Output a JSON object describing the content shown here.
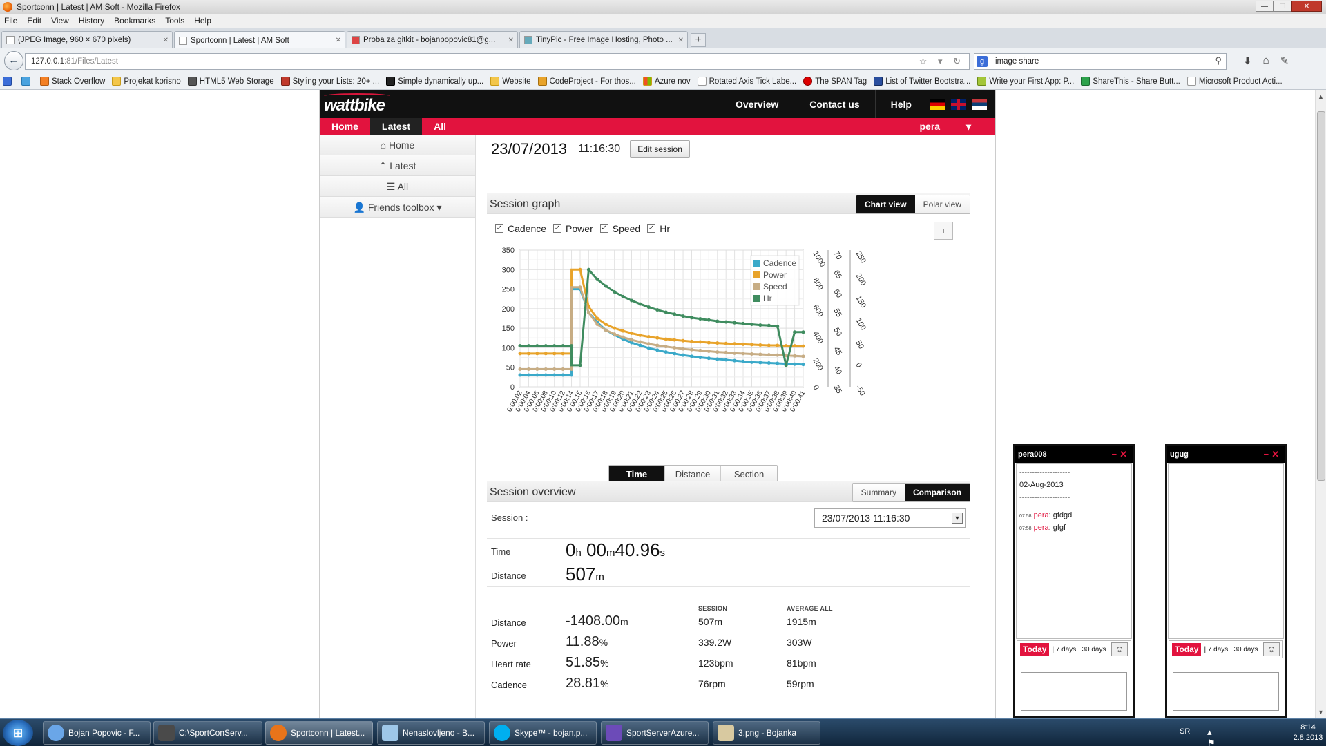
{
  "window": {
    "title": "Sportconn | Latest | AM Soft - Mozilla Firefox"
  },
  "menu": [
    "File",
    "Edit",
    "View",
    "History",
    "Bookmarks",
    "Tools",
    "Help"
  ],
  "tabs": [
    {
      "label": "(JPEG Image, 960 × 670 pixels)",
      "active": false
    },
    {
      "label": "Sportconn | Latest | AM Soft",
      "active": true
    },
    {
      "label": "Proba za gitkit - bojanpopovic81@g...",
      "active": false
    },
    {
      "label": "TinyPic - Free Image Hosting, Photo ...",
      "active": false
    }
  ],
  "address": {
    "host": "127.0.0.1",
    "rest": ":81/Files/Latest"
  },
  "search": {
    "value": "image share"
  },
  "bookmarks": [
    "Stack Overflow",
    "Projekat korisno",
    "HTML5 Web Storage",
    "Styling your Lists: 20+ ...",
    "Simple dynamically up...",
    "Website",
    "CodeProject - For thos...",
    "Azure nov",
    "Rotated Axis Tick Labe...",
    "The SPAN Tag",
    "List of Twitter Bootstra...",
    "Write your First App: P...",
    "ShareThis - Share Butt...",
    "Microsoft Product Acti..."
  ],
  "site": {
    "logo": "wattbike",
    "topnav": [
      "Overview",
      "Contact us",
      "Help"
    ],
    "subnav": [
      "Home",
      "Latest",
      "All"
    ],
    "user": "pera",
    "sidebar": [
      "Home",
      "Latest",
      "All",
      "Friends toolbox"
    ],
    "session_date": "23/07/2013",
    "session_time": "11:16:30",
    "edit_btn": "Edit session",
    "graph_title": "Session graph",
    "chart_view": "Chart view",
    "polar_view": "Polar view",
    "series_checks": [
      "Cadence",
      "Power",
      "Speed",
      "Hr"
    ],
    "zoom": "+",
    "xaxis_modes": [
      "Time",
      "Distance",
      "Section"
    ],
    "overview_title": "Session overview",
    "summary_btn": "Summary",
    "comparison_btn": "Comparison",
    "session_label": "Session :",
    "session_select": "23/07/2013 11:16:30",
    "time_label": "Time",
    "time_h": "0",
    "time_h_unit": "h",
    "time_m": " 00",
    "time_m_unit": "m",
    "time_s": "40.96",
    "time_s_unit": "s",
    "distance_label": "Distance",
    "distance_val": "507",
    "distance_unit": "m",
    "col_session": "SESSION",
    "col_avg": "AVERAGE ALL",
    "stats": [
      {
        "label": "Distance",
        "pct": "-1408.00",
        "unit": "m",
        "session": "507m",
        "avg": "1915m"
      },
      {
        "label": "Power",
        "pct": "11.88",
        "unit": "%",
        "session": "339.2W",
        "avg": "303W"
      },
      {
        "label": "Heart rate",
        "pct": "51.85",
        "unit": "%",
        "session": "123bpm",
        "avg": "81bpm"
      },
      {
        "label": "Cadence",
        "pct": "28.81",
        "unit": "%",
        "session": "76rpm",
        "avg": "59rpm"
      }
    ]
  },
  "chart_data": {
    "type": "line",
    "x": [
      "0:00:02",
      "0:00:04",
      "0:00:06",
      "0:00:08",
      "0:00:10",
      "0:00:12",
      "0:00:14",
      "0:00:15",
      "0:00:16",
      "0:00:17",
      "0:00:18",
      "0:00:19",
      "0:00:20",
      "0:00:21",
      "0:00:22",
      "0:00:23",
      "0:00:24",
      "0:00:25",
      "0:00:26",
      "0:00:27",
      "0:00:28",
      "0:00:29",
      "0:00:30",
      "0:00:31",
      "0:00:32",
      "0:00:33",
      "0:00:34",
      "0:00:35",
      "0:00:36",
      "0:00:37",
      "0:00:38",
      "0:00:39",
      "0:00:40",
      "0:00:41"
    ],
    "series": [
      {
        "name": "Cadence",
        "color": "#3aa9c9",
        "values": [
          30,
          30,
          30,
          30,
          30,
          30,
          30,
          250,
          190,
          165,
          145,
          133,
          122,
          113,
          106,
          99,
          94,
          89,
          85,
          81,
          78,
          75,
          73,
          71,
          69,
          67,
          65,
          63,
          62,
          61,
          60,
          59,
          58,
          57
        ]
      },
      {
        "name": "Power",
        "color": "#e8a32a",
        "values": [
          85,
          85,
          85,
          85,
          85,
          85,
          85,
          300,
          205,
          175,
          160,
          150,
          143,
          137,
          132,
          128,
          125,
          122,
          120,
          118,
          116,
          115,
          113,
          112,
          111,
          110,
          109,
          108,
          107,
          106,
          106,
          105,
          105,
          104
        ]
      },
      {
        "name": "Speed",
        "color": "#c7ad85",
        "values": [
          45,
          45,
          45,
          45,
          45,
          45,
          45,
          255,
          190,
          160,
          145,
          135,
          127,
          120,
          115,
          110,
          106,
          103,
          100,
          97,
          95,
          93,
          91,
          89,
          88,
          86,
          85,
          84,
          83,
          82,
          81,
          80,
          79,
          78
        ]
      },
      {
        "name": "Hr",
        "color": "#3f8c5f",
        "values": [
          105,
          105,
          105,
          105,
          105,
          105,
          105,
          55,
          300,
          275,
          258,
          243,
          231,
          221,
          212,
          204,
          197,
          191,
          186,
          181,
          177,
          174,
          171,
          168,
          166,
          164,
          162,
          160,
          158,
          157,
          155,
          55,
          140,
          140
        ]
      }
    ],
    "y_axes": [
      {
        "ticks": [
          "350",
          "300",
          "250",
          "200",
          "150",
          "100",
          "50",
          "0"
        ]
      },
      {
        "ticks": [
          "1000",
          "800",
          "600",
          "400",
          "200",
          "0"
        ]
      },
      {
        "ticks": [
          "70",
          "65",
          "60",
          "55",
          "50",
          "45",
          "40",
          "35"
        ]
      },
      {
        "ticks": [
          "250",
          "200",
          "150",
          "100",
          "50",
          "0",
          "-50"
        ]
      }
    ],
    "ylim": [
      0,
      350
    ],
    "grid": true,
    "legend": "top-right"
  },
  "chats": [
    {
      "user": "pera008",
      "lines": [
        "--------------------",
        "02-Aug-2013",
        "--------------------"
      ],
      "messages": [
        {
          "time": "07:58",
          "name": "pera",
          "text": ": gfdgd"
        },
        {
          "time": "07:58",
          "name": "pera",
          "text": ": gfgf"
        }
      ],
      "today": "Today",
      "ranges": "| 7 days | 30 days"
    },
    {
      "user": "ugug",
      "lines": [],
      "messages": [],
      "today": "Today",
      "ranges": "| 7 days | 30 days"
    }
  ],
  "taskbar": [
    {
      "label": "Bojan Popovic - F..."
    },
    {
      "label": "C:\\SportConServ..."
    },
    {
      "label": "Sportconn | Latest..."
    },
    {
      "label": "Nenaslovljeno - B..."
    },
    {
      "label": "Skype™ - bojan.p..."
    },
    {
      "label": "SportServerAzure..."
    },
    {
      "label": "3.png - Bojanka"
    }
  ],
  "tray": {
    "lang": "SR",
    "time": "8:14",
    "date": "2.8.2013"
  }
}
